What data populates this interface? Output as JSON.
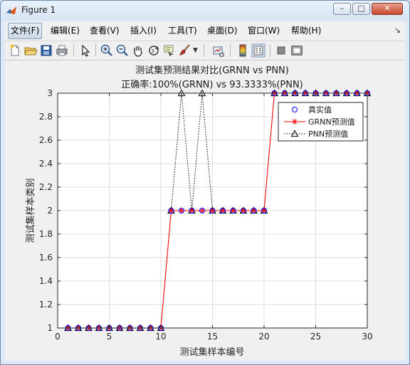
{
  "window": {
    "title": "Figure 1",
    "minimize": "–",
    "maximize": "□",
    "close": "✕"
  },
  "menu": {
    "items": [
      {
        "label": "文件(F)",
        "active": true
      },
      {
        "label": "编辑(E)"
      },
      {
        "label": "查看(V)"
      },
      {
        "label": "插入(I)"
      },
      {
        "label": "工具(T)"
      },
      {
        "label": "桌面(D)"
      },
      {
        "label": "窗口(W)"
      },
      {
        "label": "帮助(H)"
      }
    ],
    "overflow": "↘"
  },
  "toolbar": {
    "icons": [
      "new-figure-icon",
      "open-file-icon",
      "save-icon",
      "print-icon",
      "pointer-icon",
      "zoom-in-icon",
      "zoom-out-icon",
      "pan-icon",
      "rotate-3d-icon",
      "data-cursor-icon",
      "brush-icon",
      "link-icon",
      "colorbar-icon",
      "legend-icon",
      "hide-plot-tools-icon",
      "show-plot-tools-icon"
    ]
  },
  "colors": {
    "true": "#0000ff",
    "grnn": "#ff0000",
    "pnn": "#000000",
    "grid": "#dcdcdc"
  },
  "chart_data": {
    "type": "line",
    "title": "测试集预测结果对比(GRNN vs PNN)",
    "subtitle": "正确率:100%(GRNN) vs 93.3333%(PNN)",
    "xlabel": "测试集样本编号",
    "ylabel": "测试集样本类别",
    "xlim": [
      0,
      30
    ],
    "ylim": [
      1,
      3
    ],
    "xticks": [
      0,
      5,
      10,
      15,
      20,
      25,
      30
    ],
    "yticks": [
      1,
      1.2,
      1.4,
      1.6,
      1.8,
      2,
      2.2,
      2.4,
      2.6,
      2.8,
      3
    ],
    "grid": true,
    "legend_position": "top-right",
    "x": [
      1,
      2,
      3,
      4,
      5,
      6,
      7,
      8,
      9,
      10,
      11,
      12,
      13,
      14,
      15,
      16,
      17,
      18,
      19,
      20,
      21,
      22,
      23,
      24,
      25,
      26,
      27,
      28,
      29,
      30
    ],
    "series": [
      {
        "name": "真实值",
        "marker": "o",
        "line": "none",
        "color": "#0000ff",
        "values": [
          1,
          1,
          1,
          1,
          1,
          1,
          1,
          1,
          1,
          1,
          2,
          2,
          2,
          2,
          2,
          2,
          2,
          2,
          2,
          2,
          3,
          3,
          3,
          3,
          3,
          3,
          3,
          3,
          3,
          3
        ]
      },
      {
        "name": "GRNN预测值",
        "marker": "*",
        "line": "solid",
        "color": "#ff0000",
        "values": [
          1,
          1,
          1,
          1,
          1,
          1,
          1,
          1,
          1,
          1,
          2,
          2,
          2,
          2,
          2,
          2,
          2,
          2,
          2,
          2,
          3,
          3,
          3,
          3,
          3,
          3,
          3,
          3,
          3,
          3
        ]
      },
      {
        "name": "PNN预测值",
        "marker": "^",
        "line": "dotted",
        "color": "#000000",
        "values": [
          1,
          1,
          1,
          1,
          1,
          1,
          1,
          1,
          1,
          1,
          2,
          3,
          2,
          3,
          2,
          2,
          2,
          2,
          2,
          2,
          3,
          3,
          3,
          3,
          3,
          3,
          3,
          3,
          3,
          3
        ]
      }
    ]
  }
}
